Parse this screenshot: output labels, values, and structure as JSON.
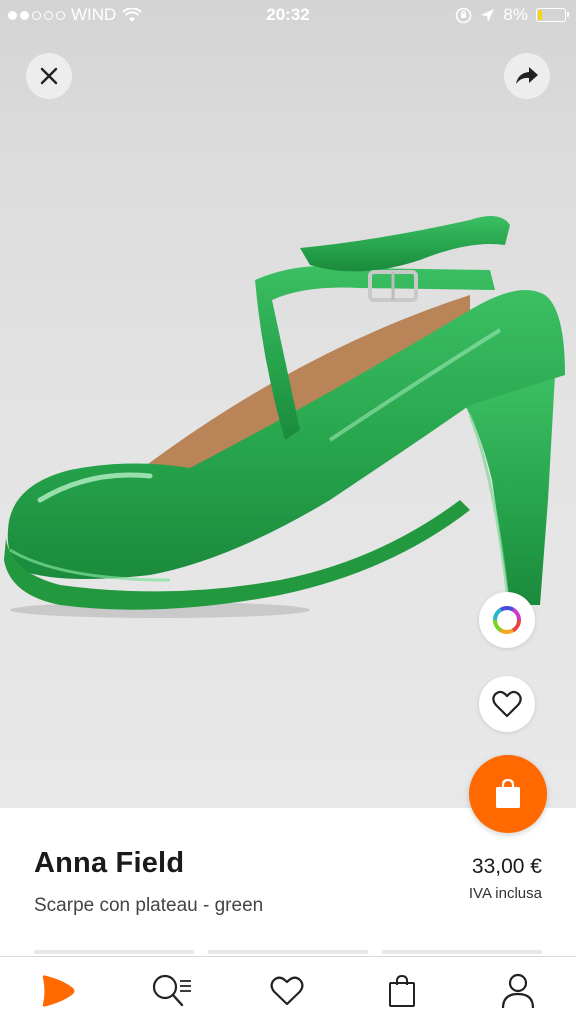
{
  "status_bar": {
    "carrier": "WIND",
    "time": "20:32",
    "battery": "8%",
    "signal_bars_filled": 2,
    "signal_bars_total": 5
  },
  "top_actions": {
    "close_icon": "close-icon",
    "share_icon": "share-arrow-icon"
  },
  "product_image": {
    "description_icon": "green-patent-platform-pump",
    "color": "#2fa84f"
  },
  "side_actions": {
    "color_picker_icon": "color-wheel-icon",
    "wishlist_icon": "heart-icon",
    "cart_icon": "shopping-bag-icon",
    "cart_color": "#ff6900"
  },
  "product": {
    "brand": "Anna Field",
    "name": "Scarpe con plateau - green",
    "price": "33,00 €",
    "vat_note": "IVA inclusa"
  },
  "tab_bar": {
    "items": [
      {
        "icon": "zalando-logo-icon",
        "active": true
      },
      {
        "icon": "search-list-icon"
      },
      {
        "icon": "heart-icon"
      },
      {
        "icon": "shopping-bag-icon"
      },
      {
        "icon": "user-icon"
      }
    ],
    "accent": "#ff6900"
  }
}
